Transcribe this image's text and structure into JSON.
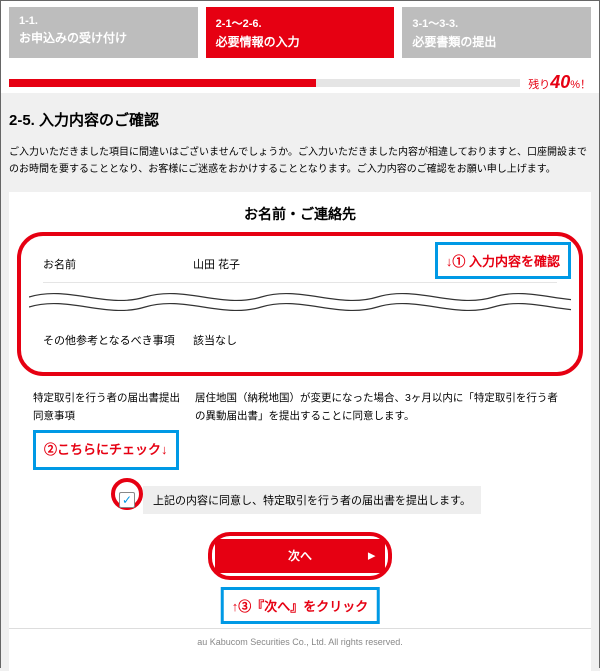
{
  "steps": [
    {
      "code": "1-1.",
      "title": "お申込みの受け付け"
    },
    {
      "code": "2-1～2-6.",
      "title": "必要情報の入力"
    },
    {
      "code": "3-1～3-3.",
      "title": "必要書類の提出"
    }
  ],
  "progress": {
    "label": "残り",
    "percent": "40",
    "unit": "%！"
  },
  "section_title": "2-5. 入力内容のご確認",
  "note": "ご入力いただきました項目に間違いはございませんでしょうか。ご入力いただきました内容が相違しておりますと、口座開設までのお時間を要することとなり、お客様にご迷惑をおかけすることとなります。ご入力内容のご確認をお願い申し上げます。",
  "card_title": "お名前・ご連絡先",
  "rows": {
    "name_label": "お名前",
    "name_value": "山田 花子",
    "other_label": "その他参考となるべき事項",
    "other_value": "該当なし"
  },
  "consent": {
    "label": "特定取引を行う者の届出書提出同意事項",
    "text": "居住地国（納税地国）が変更になった場合、3ヶ月以内に「特定取引を行う者の異動届出書」を提出することに同意します。"
  },
  "check_label": "上記の内容に同意し、特定取引を行う者の届出書を提出します。",
  "next_label": "次へ",
  "annotations": {
    "a1": "↓① 入力内容を確認",
    "a2": "②こちらにチェック↓",
    "a3": "↑③『次へ』をクリック"
  },
  "footer": "au Kabucom Securities Co., Ltd. All rights reserved."
}
